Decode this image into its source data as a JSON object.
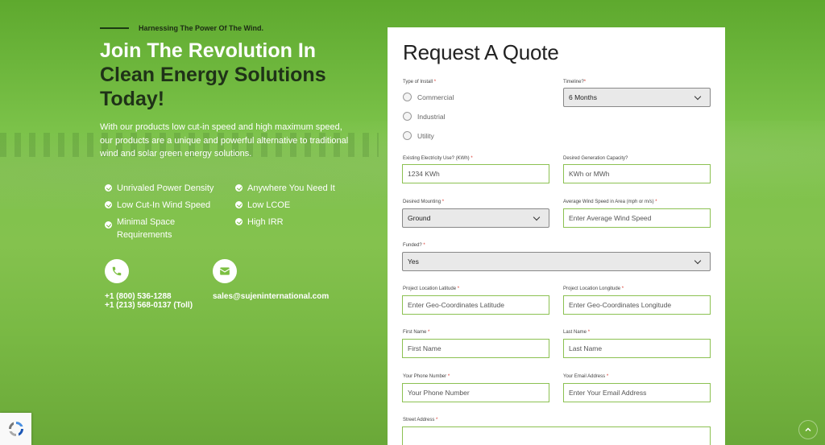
{
  "hero": {
    "tagline": "Harnessing The Power Of The Wind.",
    "headline_part1": "Join The Revolution In",
    "headline_part2": "Clean Energy Solutions",
    "headline_part3": "Today!",
    "description": "With our products low cut-in speed and high maximum speed, our products are a unique and powerful alternative to traditional wind and solar green energy solutions."
  },
  "features": [
    "Unrivaled Power Density",
    "Anywhere You Need It",
    "Low Cut-In Wind Speed",
    "Low LCOE",
    "Minimal Space Requirements",
    "High IRR"
  ],
  "contact": {
    "phone_icon": "phone-icon",
    "phone1": "+1 (800) 536-1288",
    "phone2": "+1 (213) 568-0137 (Toll)",
    "email_icon": "envelope-icon",
    "email": "sales@sujeninternational.com"
  },
  "form": {
    "title": "Request A Quote",
    "required_mark": "*",
    "type_of_install_label": "Type of Install",
    "install_options": [
      "Commercial",
      "Industrial",
      "Utility"
    ],
    "timeline_label": "Timeline?",
    "timeline_value": "6 Months",
    "electricity_label": "Existing Electricity Use? (KWh)",
    "electricity_placeholder": "1234 KWh",
    "capacity_label": "Desired Generation Capacity?",
    "capacity_placeholder": "KWh or MWh",
    "mounting_label": "Desired Mounting",
    "mounting_value": "Ground",
    "wind_speed_label": "Average Wind Speed in Area (mph or m/s)",
    "wind_speed_placeholder": "Enter Average Wind Speed",
    "funded_label": "Funded?",
    "funded_value": "Yes",
    "latitude_label": "Project Location Latitude",
    "latitude_placeholder": "Enter Geo-Coordinates Latitude",
    "longitude_label": "Project Location Longitude",
    "longitude_placeholder": "Enter Geo-Coordinates Longitude",
    "first_name_label": "First Name",
    "first_name_placeholder": "First Name",
    "last_name_label": "Last Name",
    "last_name_placeholder": "Last Name",
    "phone_label": "Your Phone Number",
    "phone_placeholder": "Your Phone Number",
    "email_label": "Your Email Address",
    "email_placeholder": "Enter Your Email Address",
    "street_label": "Street Address"
  },
  "colors": {
    "accent_green": "#8cc152",
    "required_red": "#d9342b",
    "dark_heading": "#1f3218"
  }
}
